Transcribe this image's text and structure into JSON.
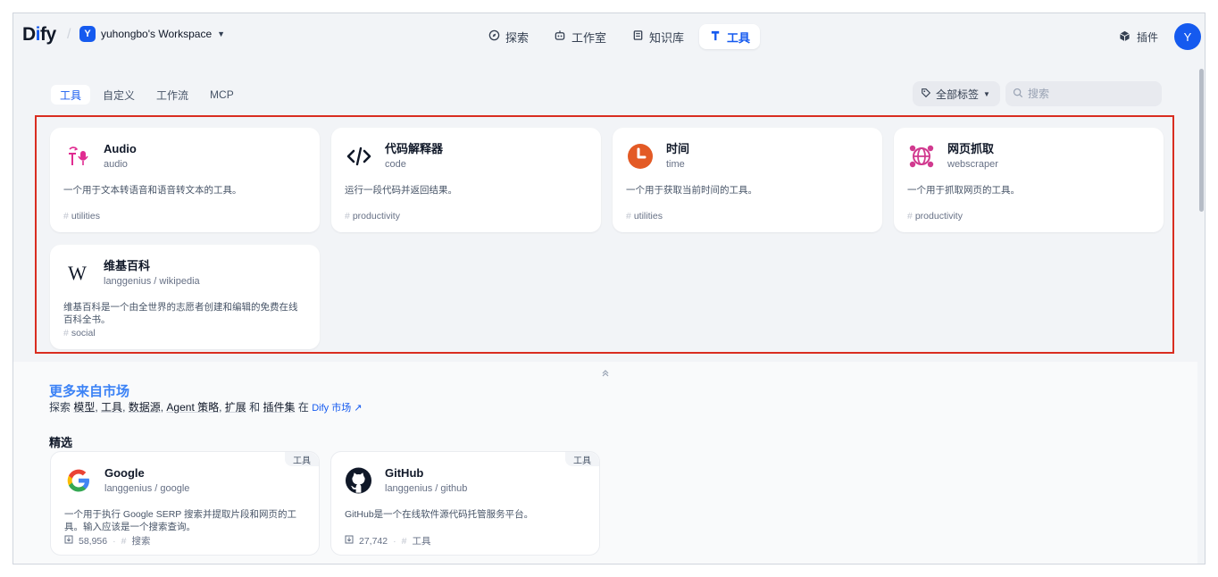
{
  "app": {
    "logo_prefix": "D",
    "logo_i": "i",
    "logo_suffix": "fy"
  },
  "workspace": {
    "initial": "Y",
    "name": "yuhongbo's Workspace"
  },
  "nav": [
    {
      "label": "探索",
      "icon": "compass-icon",
      "active": false
    },
    {
      "label": "工作室",
      "icon": "robot-icon",
      "active": false
    },
    {
      "label": "知识库",
      "icon": "book-icon",
      "active": false
    },
    {
      "label": "工具",
      "icon": "tool-icon",
      "active": true
    }
  ],
  "header": {
    "plugins_label": "插件",
    "avatar_initial": "Y"
  },
  "tabs": [
    "工具",
    "自定义",
    "工作流",
    "MCP"
  ],
  "filters": {
    "tag_label": "全部标签",
    "search_placeholder": "搜索"
  },
  "tools": [
    {
      "name": "Audio",
      "sub": "audio",
      "desc": "一个用于文本转语音和语音转文本的工具。",
      "tag": "utilities",
      "icon": "audio-icon"
    },
    {
      "name": "代码解释器",
      "sub": "code",
      "desc": "运行一段代码并返回结果。",
      "tag": "productivity",
      "icon": "code-icon"
    },
    {
      "name": "时间",
      "sub": "time",
      "desc": "一个用于获取当前时间的工具。",
      "tag": "utilities",
      "icon": "clock-icon"
    },
    {
      "name": "网页抓取",
      "sub": "webscraper",
      "desc": "一个用于抓取网页的工具。",
      "tag": "productivity",
      "icon": "globe-icon"
    },
    {
      "name": "维基百科",
      "sub": "langgenius / wikipedia",
      "desc": "维基百科是一个由全世界的志愿者创建和编辑的免费在线百科全书。",
      "tag": "social",
      "icon": "wikipedia-icon"
    }
  ],
  "marketplace": {
    "title": "更多来自市场",
    "line_prefix": "探索",
    "items": [
      "模型",
      "工具",
      "数据源",
      "Agent 策略",
      "扩展"
    ],
    "and": "和",
    "bundle": "插件集",
    "in": "在",
    "link": "Dify 市场 ↗",
    "featured_label": "精选",
    "collapse_icon": "chevron-double-up-icon"
  },
  "featured": [
    {
      "name": "Google",
      "sub": "langgenius / google",
      "badge": "工具",
      "desc": "一个用于执行 Google SERP 搜索并提取片段和网页的工具。输入应该是一个搜索查询。",
      "installs": "58,956",
      "tag": "搜索",
      "icon": "google-icon"
    },
    {
      "name": "GitHub",
      "sub": "langgenius / github",
      "badge": "工具",
      "desc": "GitHub是一个在线软件源代码托管服务平台。",
      "installs": "27,742",
      "tag": "工具",
      "icon": "github-icon"
    }
  ],
  "colors": {
    "accent": "#155aef",
    "highlight_border": "#d92d20",
    "audio": "#e02c91",
    "clock": "#e35a25",
    "globe": "#d13a8f"
  }
}
